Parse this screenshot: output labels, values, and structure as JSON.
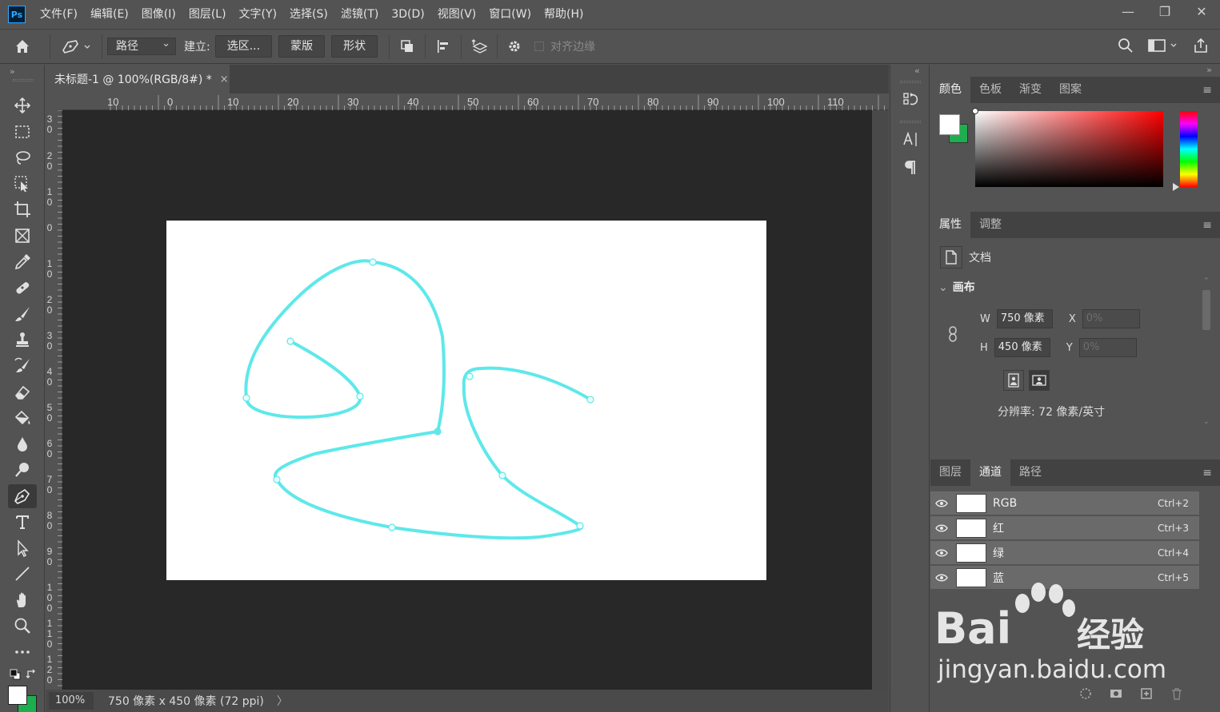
{
  "app": {
    "logo": "Ps"
  },
  "menu": [
    "文件(F)",
    "编辑(E)",
    "图像(I)",
    "图层(L)",
    "文字(Y)",
    "选择(S)",
    "滤镜(T)",
    "3D(D)",
    "视图(V)",
    "窗口(W)",
    "帮助(H)"
  ],
  "window_controls": {
    "minimize": "—",
    "restore": "❐",
    "close": "✕"
  },
  "options": {
    "mode_select": "路径",
    "make_label": "建立:",
    "selection_btn": "选区...",
    "mask_btn": "蒙版",
    "shape_btn": "形状",
    "align_edges": "对齐边缘"
  },
  "document": {
    "tab_title": "未标题-1 @ 100%(RGB/8#) *",
    "close": "×",
    "zoom": "100%",
    "info": "750 像素 x 450 像素 (72 ppi)",
    "status_arrow": "〉"
  },
  "ruler": {
    "h_labels": [
      "10",
      "0",
      "10",
      "20",
      "30",
      "40",
      "50",
      "60",
      "70",
      "80",
      "90",
      "100",
      "110"
    ],
    "v_labels": [
      "3 0",
      "2 0",
      "1 0",
      "0",
      "1 0",
      "2 0",
      "3 0",
      "4 0",
      "5 0",
      "6 0",
      "7 0",
      "8 0",
      "9 0",
      "1 0 0",
      "1 1 0",
      "1 2 0"
    ]
  },
  "path": {
    "stroke_color": "#5ee8ea"
  },
  "color_panel": {
    "tabs": [
      "颜色",
      "色板",
      "渐变",
      "图案"
    ],
    "menu": "≡",
    "foreground": "#ffffff",
    "background": "#1fae4f"
  },
  "properties_panel": {
    "tabs": [
      "属性",
      "调整"
    ],
    "menu": "≡",
    "doc_label": "文档",
    "section": "画布",
    "w_label": "W",
    "w_value": "750 像素",
    "h_label": "H",
    "h_value": "450 像素",
    "x_label": "X",
    "x_value": "0%",
    "y_label": "Y",
    "y_value": "0%",
    "resolution": "分辨率: 72 像素/英寸"
  },
  "channels_panel": {
    "tabs": [
      "图层",
      "通道",
      "路径"
    ],
    "menu": "≡",
    "channels": [
      {
        "name": "RGB",
        "shortcut": "Ctrl+2"
      },
      {
        "name": "红",
        "shortcut": "Ctrl+3"
      },
      {
        "name": "绿",
        "shortcut": "Ctrl+4"
      },
      {
        "name": "蓝",
        "shortcut": "Ctrl+5"
      }
    ]
  },
  "watermark": {
    "brand": "Bai",
    "brand_cn": "经验",
    "url": "jingyan.baidu.com"
  }
}
